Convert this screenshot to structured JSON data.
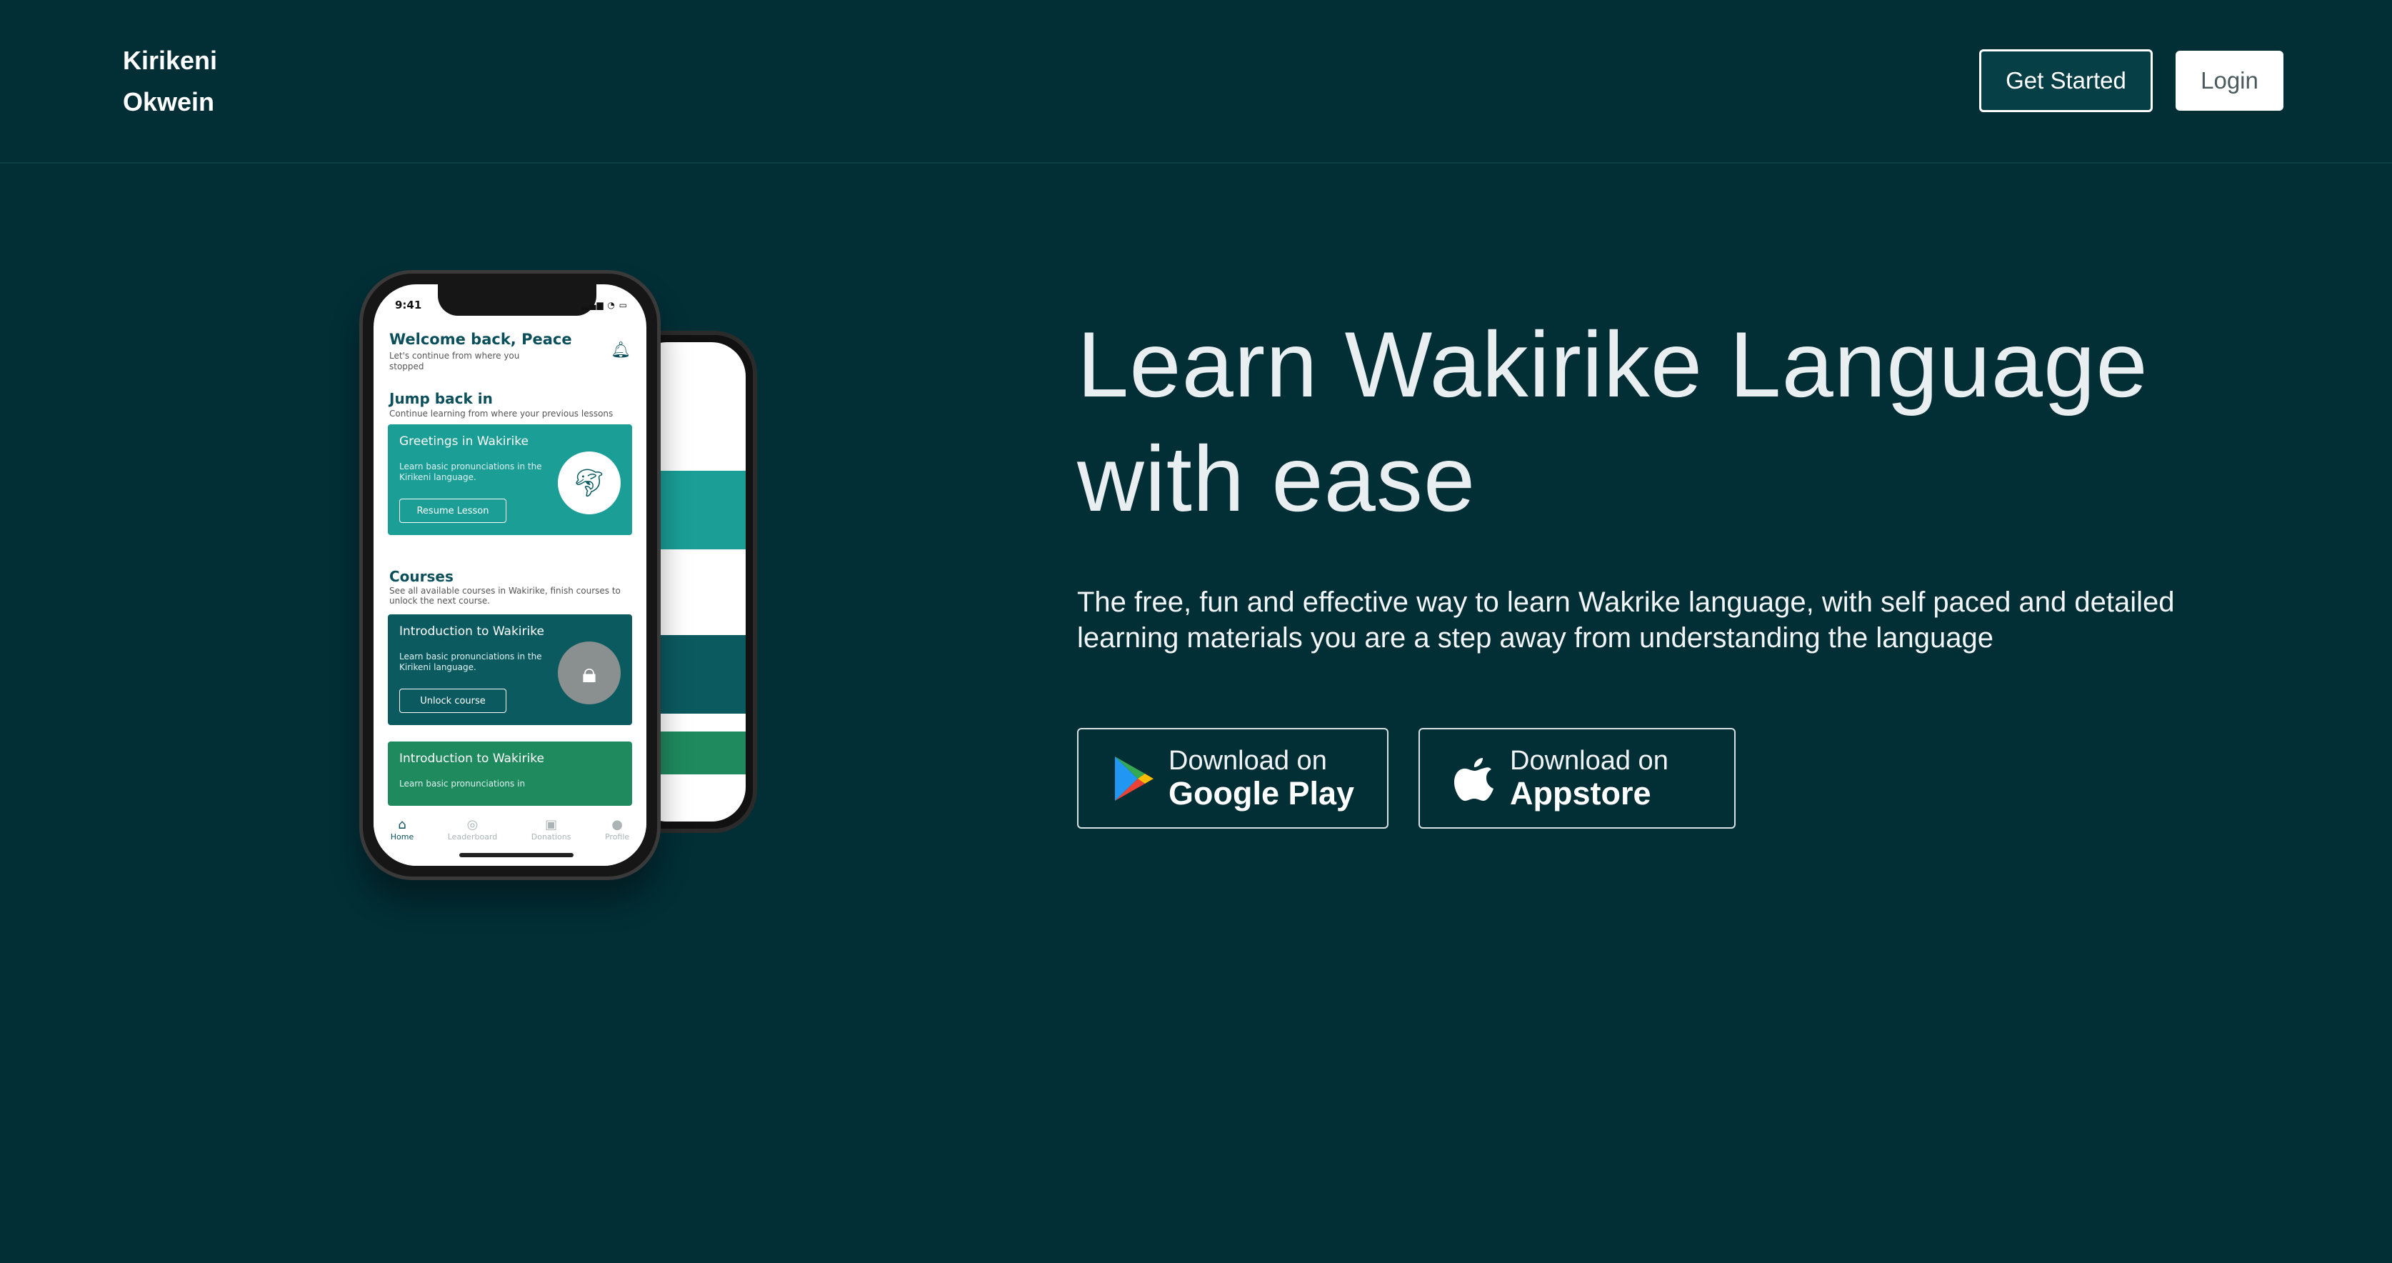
{
  "nav": {
    "brand_line1": "Kirikeni",
    "brand_line2": "Okwein",
    "get_started": "Get Started",
    "login": "Login"
  },
  "hero": {
    "title": "Learn Wakirike Language with ease",
    "subtitle": "The free, fun and effective way to learn Wakrike language, with self paced and detailed learning materials you are a step away from understanding the language"
  },
  "stores": {
    "play_small": "Download on",
    "play_big": "Google Play",
    "apple_small": "Download on",
    "apple_big": "Appstore"
  },
  "phone": {
    "time": "9:41",
    "welcome": "Welcome back, Peace",
    "welcome_sub": "Let's continue from where you stopped",
    "jump_title": "Jump back in",
    "jump_sub": "Continue learning from where your previous lessons",
    "card1": {
      "title": "Greetings in Wakirike",
      "desc": "Learn basic pronunciations in the Kirikeni language.",
      "button": "Resume Lesson"
    },
    "courses_title": "Courses",
    "courses_sub": "See all available courses in Wakirike, finish courses to unlock the next course.",
    "card2": {
      "title": "Introduction to Wakirike",
      "desc": "Learn basic pronunciations in the Kirikeni language.",
      "button": "Unlock course"
    },
    "card3": {
      "title": "Introduction to Wakirike",
      "desc": "Learn basic pronunciations in"
    },
    "tabs": [
      "Home",
      "Leaderboard",
      "Donations",
      "Profile"
    ]
  },
  "colors": {
    "background": "#022e36",
    "card_teal": "#1a9e96",
    "card_dark": "#0b5a60",
    "card_green": "#1f8a5e"
  }
}
